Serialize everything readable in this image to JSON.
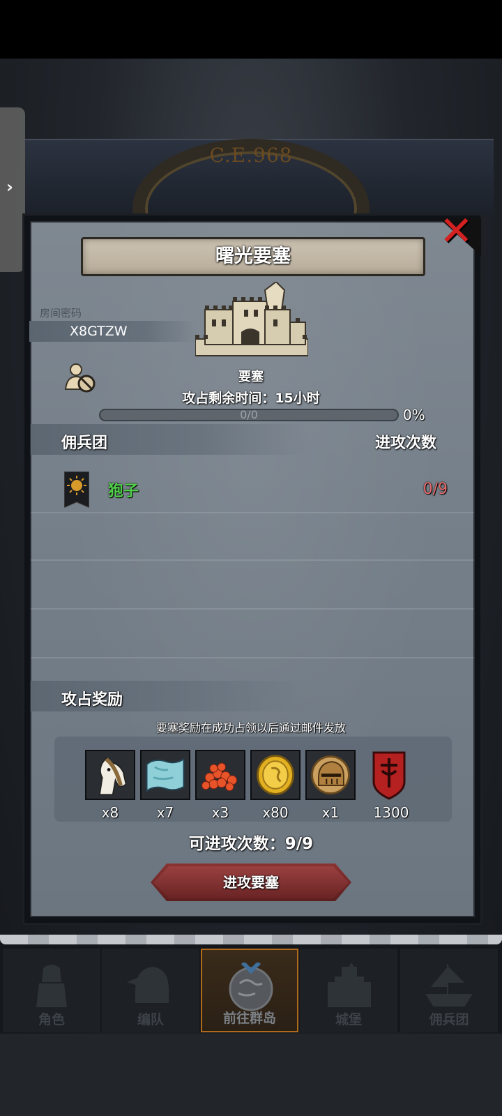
{
  "background": {
    "year_label": "C.E.968"
  },
  "dialog": {
    "title": "曙光要塞",
    "room_password_label": "房间密码",
    "room_code": "X8GTZW",
    "fortress_type": "要塞",
    "time_left": "攻占剩余时间：15小时",
    "progress_text": "0/0",
    "progress_percent": "0%",
    "progress_value": 0
  },
  "mercenary_section": {
    "header_left": "佣兵团",
    "header_right": "进攻次数",
    "rows": [
      {
        "name": "狍子",
        "attacks": "0/9",
        "banner_icon": "sun-banner-icon"
      }
    ]
  },
  "reward_section": {
    "header": "攻占奖励",
    "note": "要塞奖励在成功占领以后通过邮件发放",
    "items": [
      {
        "icon": "horse-icon",
        "qty": "x8"
      },
      {
        "icon": "cloth-icon",
        "qty": "x7"
      },
      {
        "icon": "berries-icon",
        "qty": "x3"
      },
      {
        "icon": "gold-coin-icon",
        "qty": "x80"
      },
      {
        "icon": "knight-helmet-icon",
        "qty": "x1"
      },
      {
        "icon": "red-crest-icon",
        "qty": "1300"
      }
    ],
    "attacks_available": "可进攻次数：9/9",
    "attack_button": "进攻要塞"
  },
  "nav": {
    "items": [
      {
        "label": "角色",
        "icon": "knight-icon"
      },
      {
        "label": "编队",
        "icon": "helmet-formation-icon"
      },
      {
        "label": "前往群岛",
        "icon": "globe-icon",
        "active": true
      },
      {
        "label": "城堡",
        "icon": "castle-icon"
      },
      {
        "label": "佣兵团",
        "icon": "ship-icon"
      }
    ]
  },
  "colors": {
    "accent_green": "#50d048",
    "count_red": "#e36a6a",
    "close_red": "#d32020",
    "button_red": "#8a3434",
    "nav_active_border": "#b06a1e"
  }
}
